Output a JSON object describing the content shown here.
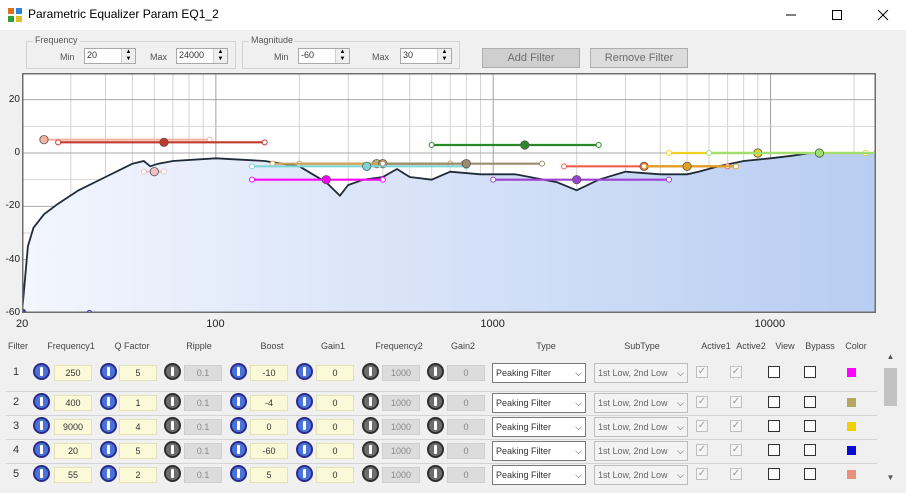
{
  "window": {
    "title": "Parametric Equalizer Param EQ1_2"
  },
  "frequency_group": {
    "title": "Frequency",
    "min_label": "Min",
    "min_value": "20",
    "max_label": "Max",
    "max_value": "24000"
  },
  "magnitude_group": {
    "title": "Magnitude",
    "min_label": "Min",
    "min_value": "-60",
    "max_label": "Max",
    "max_value": "30"
  },
  "toolbar": {
    "add_filter": "Add Filter",
    "remove_filter": "Remove Filter"
  },
  "chart_data": {
    "type": "line",
    "x_scale": "log",
    "xlim": [
      20,
      24000
    ],
    "ylim": [
      -60,
      30
    ],
    "xticks": [
      "20",
      "100",
      "1000",
      "10000"
    ],
    "yticks": [
      "20",
      "0",
      "-20",
      "-40",
      "-60"
    ],
    "grid": true,
    "response_curve": {
      "x": [
        20,
        21,
        22,
        24,
        27,
        32,
        40,
        50,
        55,
        58,
        62,
        70,
        100,
        150,
        200,
        250,
        280,
        300,
        340,
        400,
        450,
        500,
        600,
        700,
        900,
        1200,
        1700,
        2000,
        2400,
        3000,
        4000,
        5000,
        5500,
        6500,
        8000,
        10000,
        12000,
        14000,
        17000,
        24000
      ],
      "y": [
        -60,
        -35,
        -28,
        -23,
        -19,
        -14,
        -9,
        -4,
        -3,
        -5,
        -4,
        -3,
        -2,
        -3,
        -5,
        -11,
        -16,
        -12,
        -10,
        -9,
        -6,
        -9,
        -10,
        -7,
        -8,
        -8,
        -11,
        -14,
        -10,
        -7,
        -8,
        -8,
        -7,
        -5,
        -3,
        -2,
        -1,
        0,
        0,
        0
      ]
    },
    "filter_bands": [
      {
        "freq": 24,
        "gain": 5,
        "x_range": [
          24,
          95
        ],
        "color": "#f3b4a0"
      },
      {
        "freq": 65,
        "gain": 4,
        "x_range": [
          27,
          150
        ],
        "color": "#c0392b"
      },
      {
        "freq": 60,
        "gain": -7,
        "x_range": [
          55,
          65
        ],
        "color": "#f0c0c0"
      },
      {
        "freq": 250,
        "gain": -10,
        "x_range": [
          135,
          400
        ],
        "color": "#ff00ff"
      },
      {
        "freq": 380,
        "gain": -4,
        "x_range": [
          200,
          700
        ],
        "color": "#b8b070"
      },
      {
        "freq": 400,
        "gain": -4,
        "x_range": [
          160,
          780
        ],
        "color": "#d2a050"
      },
      {
        "freq": 350,
        "gain": -5,
        "x_range": [
          135,
          800
        ],
        "color": "#7fd6d6"
      },
      {
        "freq": 800,
        "gain": -4,
        "x_range": [
          400,
          1500
        ],
        "color": "#9c8c6c"
      },
      {
        "freq": 1300,
        "gain": 3,
        "x_range": [
          600,
          2400
        ],
        "color": "#2a8a2a"
      },
      {
        "freq": 2000,
        "gain": -10,
        "x_range": [
          1000,
          4300
        ],
        "color": "#a040d0"
      },
      {
        "freq": 3500,
        "gain": -5,
        "x_range": [
          1800,
          7000
        ],
        "color": "#f06050"
      },
      {
        "freq": 5000,
        "gain": -5,
        "x_range": [
          3500,
          7500
        ],
        "color": "#e0a020"
      },
      {
        "freq": 9000,
        "gain": 0,
        "x_range": [
          4300,
          22000
        ],
        "color": "#f0d020"
      },
      {
        "freq": 15000,
        "gain": 0,
        "x_range": [
          6000,
          24000
        ],
        "color": "#a0e070"
      },
      {
        "freq": 20,
        "gain": -60,
        "x_range": [
          20,
          35
        ],
        "color": "#1020d0"
      }
    ]
  },
  "table": {
    "headers": [
      "Filter",
      "Frequency1",
      "Q Factor",
      "Ripple",
      "Boost",
      "Gain1",
      "Frequency2",
      "Gain2",
      "Type",
      "SubType",
      "Active1",
      "Active2",
      "View",
      "Bypass",
      "Color"
    ],
    "rows": [
      {
        "num": "1",
        "frequency1": "250",
        "q": "5",
        "ripple": "0.1",
        "boost": "-10",
        "gain1": "0",
        "frequency2": "1000",
        "gain2": "0",
        "type": "Peaking Filter",
        "subtype": "1st Low, 2nd Low",
        "color": "#ff00ff"
      },
      {
        "num": "2",
        "frequency1": "400",
        "q": "1",
        "ripple": "0.1",
        "boost": "-4",
        "gain1": "0",
        "frequency2": "1000",
        "gain2": "0",
        "type": "Peaking Filter",
        "subtype": "1st Low, 2nd Low",
        "color": "#b4a860"
      },
      {
        "num": "3",
        "frequency1": "9000",
        "q": "4",
        "ripple": "0.1",
        "boost": "0",
        "gain1": "0",
        "frequency2": "1000",
        "gain2": "0",
        "type": "Peaking Filter",
        "subtype": "1st Low, 2nd Low",
        "color": "#f2d000"
      },
      {
        "num": "4",
        "frequency1": "20",
        "q": "5",
        "ripple": "0.1",
        "boost": "-60",
        "gain1": "0",
        "frequency2": "1000",
        "gain2": "0",
        "type": "Peaking Filter",
        "subtype": "1st Low, 2nd Low",
        "color": "#0b0bd8"
      },
      {
        "num": "5",
        "frequency1": "55",
        "q": "2",
        "ripple": "0.1",
        "boost": "5",
        "gain1": "0",
        "frequency2": "1000",
        "gain2": "0",
        "type": "Peaking Filter",
        "subtype": "1st Low, 2nd Low",
        "color": "#e8907c"
      }
    ]
  }
}
